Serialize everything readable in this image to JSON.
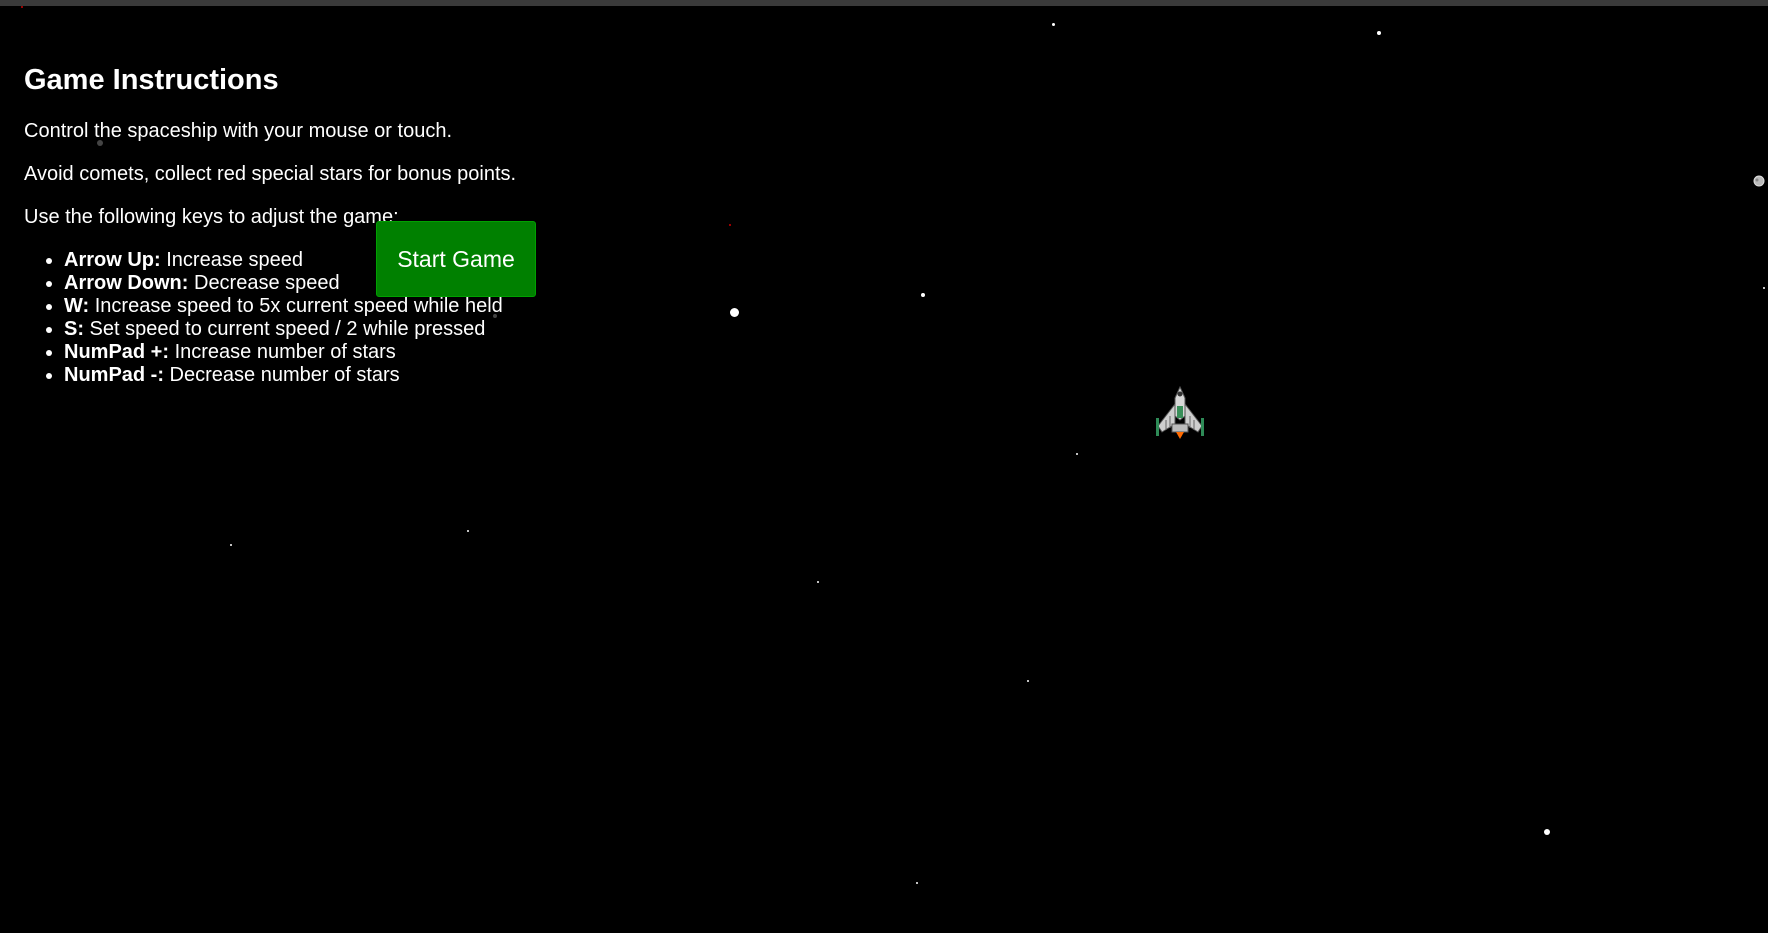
{
  "instructions": {
    "title": "Game Instructions",
    "line1": "Control the spaceship with your mouse or touch.",
    "line2": "Avoid comets, collect red special stars for bonus points.",
    "line3": "Use the following keys to adjust the game:",
    "keys": [
      {
        "key": "Arrow Up:",
        "desc": " Increase speed"
      },
      {
        "key": "Arrow Down:",
        "desc": " Decrease speed"
      },
      {
        "key": "W:",
        "desc": " Increase speed to 5x current speed while held"
      },
      {
        "key": "S:",
        "desc": " Set speed to current speed / 2 while pressed"
      },
      {
        "key": "NumPad +:",
        "desc": " Increase number of stars"
      },
      {
        "key": "NumPad -:",
        "desc": " Decrease number of stars"
      }
    ]
  },
  "start_button": {
    "label": "Start Game"
  },
  "colors": {
    "background": "#000000",
    "button": "#008000",
    "special_star": "#cc0000"
  },
  "icons": {
    "ship": "spaceship-icon",
    "comet": "comet-icon"
  }
}
